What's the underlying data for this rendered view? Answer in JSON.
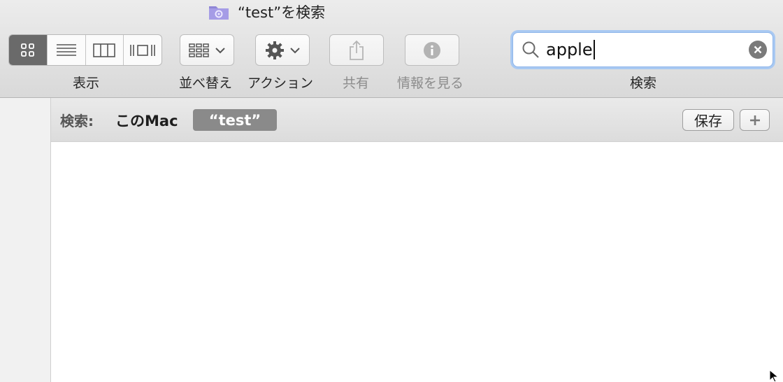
{
  "window": {
    "title": "“test”を検索",
    "title_icon": "smart-folder-icon"
  },
  "toolbar": {
    "view_modes": [
      {
        "icon": "icon-view-icon",
        "active": true
      },
      {
        "icon": "list-view-icon",
        "active": false
      },
      {
        "icon": "column-view-icon",
        "active": false
      },
      {
        "icon": "cover-flow-icon",
        "active": false
      }
    ],
    "view_label": "表示",
    "arrange_label": "並べ替え",
    "action_label": "アクション",
    "share_label": "共有",
    "info_label": "情報を見る",
    "search_label": "検索"
  },
  "search": {
    "value": "apple",
    "placeholder": "検索"
  },
  "scope": {
    "label": "検索:",
    "this_mac": "このMac",
    "selected": "“test”",
    "save_label": "保存",
    "add_label": "+"
  },
  "colors": {
    "accent_focus": "#a9c9f2",
    "selected_scope": "#8a8a8a"
  }
}
